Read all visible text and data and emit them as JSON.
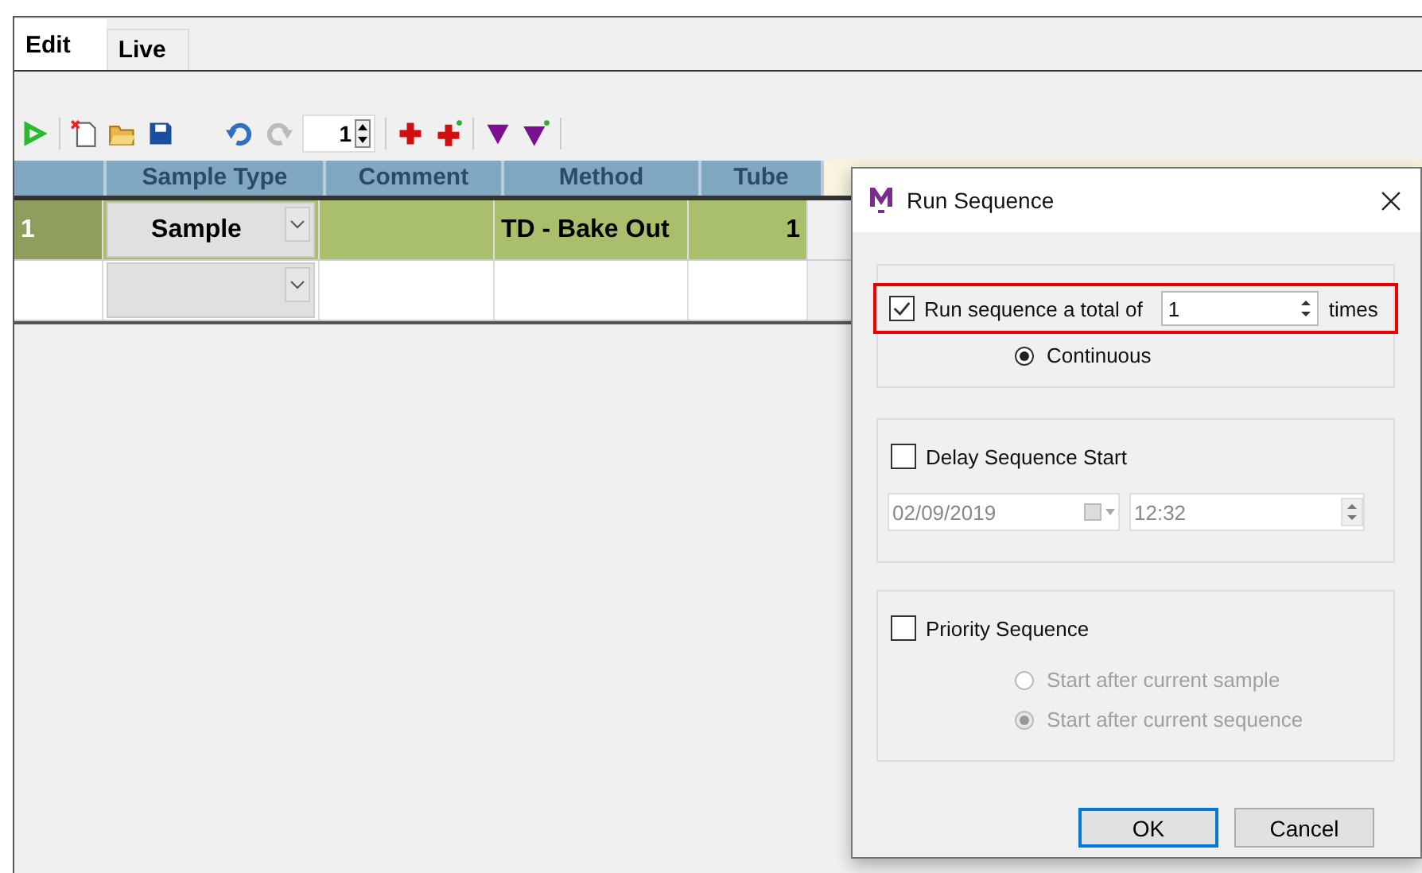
{
  "tabs": [
    {
      "label": "Edit",
      "selected": true
    },
    {
      "label": "Live",
      "selected": false
    }
  ],
  "toolbar": {
    "spinner_value": "1"
  },
  "table": {
    "columns": [
      "Sample Type",
      "Comment",
      "Method",
      "Tube"
    ],
    "rows": [
      {
        "number": "1",
        "sample_type": "Sample",
        "method": "TD - Bake Out",
        "tube": "1",
        "selected": true
      },
      {
        "selected": false
      }
    ]
  },
  "dialog": {
    "title": "Run Sequence",
    "repeat": {
      "checked": true,
      "label": "Run sequence a total of",
      "value": "1",
      "suffix": "times",
      "highlighted": true,
      "radios": [
        {
          "label": "Continuous",
          "selected": true,
          "disabled": false
        }
      ]
    },
    "delay": {
      "checked": false,
      "label": "Delay Sequence Start",
      "date": "02/09/2019",
      "time": "12:32"
    },
    "priority": {
      "checked": false,
      "label": "Priority Sequence",
      "radios": [
        {
          "label": "Start after current sample",
          "selected": false,
          "disabled": true
        },
        {
          "label": "Start after current sequence",
          "selected": true,
          "disabled": true
        }
      ]
    },
    "buttons": [
      {
        "label": "OK",
        "default": true
      },
      {
        "label": "Cancel",
        "default": false
      }
    ]
  }
}
